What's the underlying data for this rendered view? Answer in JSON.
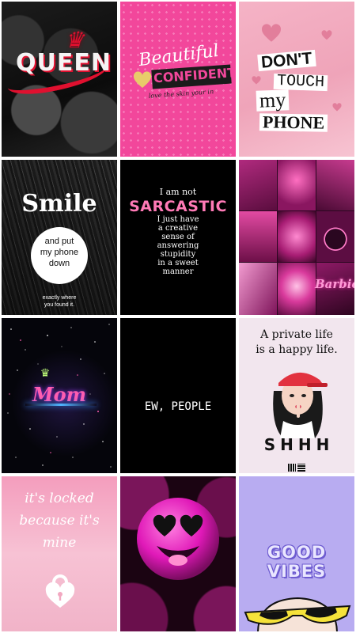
{
  "colors": {
    "page_bg": "#ffffff",
    "queen_red": "#e0102f",
    "confident_pink": "#f2479b",
    "sarcastic_pink": "#ff7ab6",
    "dont_pink": "#f5b3c6",
    "vibes_lavender": "#b8acf1"
  },
  "tiles": {
    "queen": {
      "word": "QUEEN",
      "crown": "♛",
      "icon": "crown-icon"
    },
    "confident": {
      "beautiful": "Beautiful",
      "confident": "CONFIDENT",
      "tagline": "love the skin your in",
      "icon": "heart-icon"
    },
    "dont_touch": {
      "line1": "DON'T",
      "line2": "TOUCH",
      "line3": "my",
      "line4": "PHONE",
      "icon": "heart-icon"
    },
    "smile": {
      "word": "Smile",
      "circle_text": "and put\nmy phone\ndown",
      "footer": "exactly where\nyou found it."
    },
    "sarcastic": {
      "top": "I am not",
      "word": "SARCASTIC",
      "body": "I just have\na creative\nsense of\nanswering\nstupidity\nin a sweet\nmanner"
    },
    "collage": {
      "barbie": "Barbie"
    },
    "mom": {
      "word": "Mom",
      "crown": "♛",
      "icon": "crown-icon"
    },
    "ew": {
      "text": "EW, PEOPLE"
    },
    "private": {
      "text": "A private life\nis a happy life.",
      "shhh": "SHHH"
    },
    "locked": {
      "text": "it's locked\nbecause it's\nmine",
      "icon": "lock-icon"
    },
    "smiley": {
      "icon": "heart-eyes-smiley-icon"
    },
    "vibes": {
      "line1": "GOOD",
      "line2": "VIBES",
      "icon": "sunglasses-face-icon"
    }
  }
}
